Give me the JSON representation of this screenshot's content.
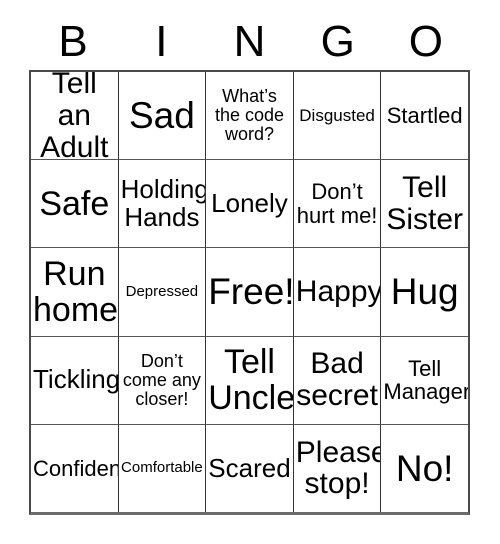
{
  "card": {
    "header_letters": [
      "B",
      "I",
      "N",
      "G",
      "O"
    ],
    "colors": {
      "background": "#ffffff",
      "text": "#000000",
      "grid_line": "#333333",
      "grid_border": "#4a4a4a"
    },
    "rows": [
      [
        {
          "text": "Tell an Adult",
          "size": "lg"
        },
        {
          "text": "Sad",
          "size": "xxl"
        },
        {
          "text": "What’s the code word?",
          "size": "xs"
        },
        {
          "text": "Disgusted",
          "size": "xxs"
        },
        {
          "text": "Startled",
          "size": "sm"
        }
      ],
      [
        {
          "text": "Safe",
          "size": "xl"
        },
        {
          "text": "Holding Hands",
          "size": "md"
        },
        {
          "text": "Lonely",
          "size": "md"
        },
        {
          "text": "Don’t hurt me!",
          "size": "sm"
        },
        {
          "text": "Tell Sister",
          "size": "lg"
        }
      ],
      [
        {
          "text": "Run home",
          "size": "xl"
        },
        {
          "text": "Depressed",
          "size": "tiny"
        },
        {
          "text": "Free!",
          "size": "xxl"
        },
        {
          "text": "Happy",
          "size": "lg"
        },
        {
          "text": "Hug",
          "size": "xxl"
        }
      ],
      [
        {
          "text": "Tickling",
          "size": "md"
        },
        {
          "text": "Don’t come any closer!",
          "size": "xs"
        },
        {
          "text": "Tell Uncle",
          "size": "xl"
        },
        {
          "text": "Bad secret",
          "size": "lg"
        },
        {
          "text": "Tell Manager",
          "size": "sm"
        }
      ],
      [
        {
          "text": "Confident",
          "size": "sm"
        },
        {
          "text": "Comfortable",
          "size": "tiny"
        },
        {
          "text": "Scared",
          "size": "md"
        },
        {
          "text": "Please stop!",
          "size": "lg"
        },
        {
          "text": "No!",
          "size": "xxl"
        }
      ]
    ]
  }
}
